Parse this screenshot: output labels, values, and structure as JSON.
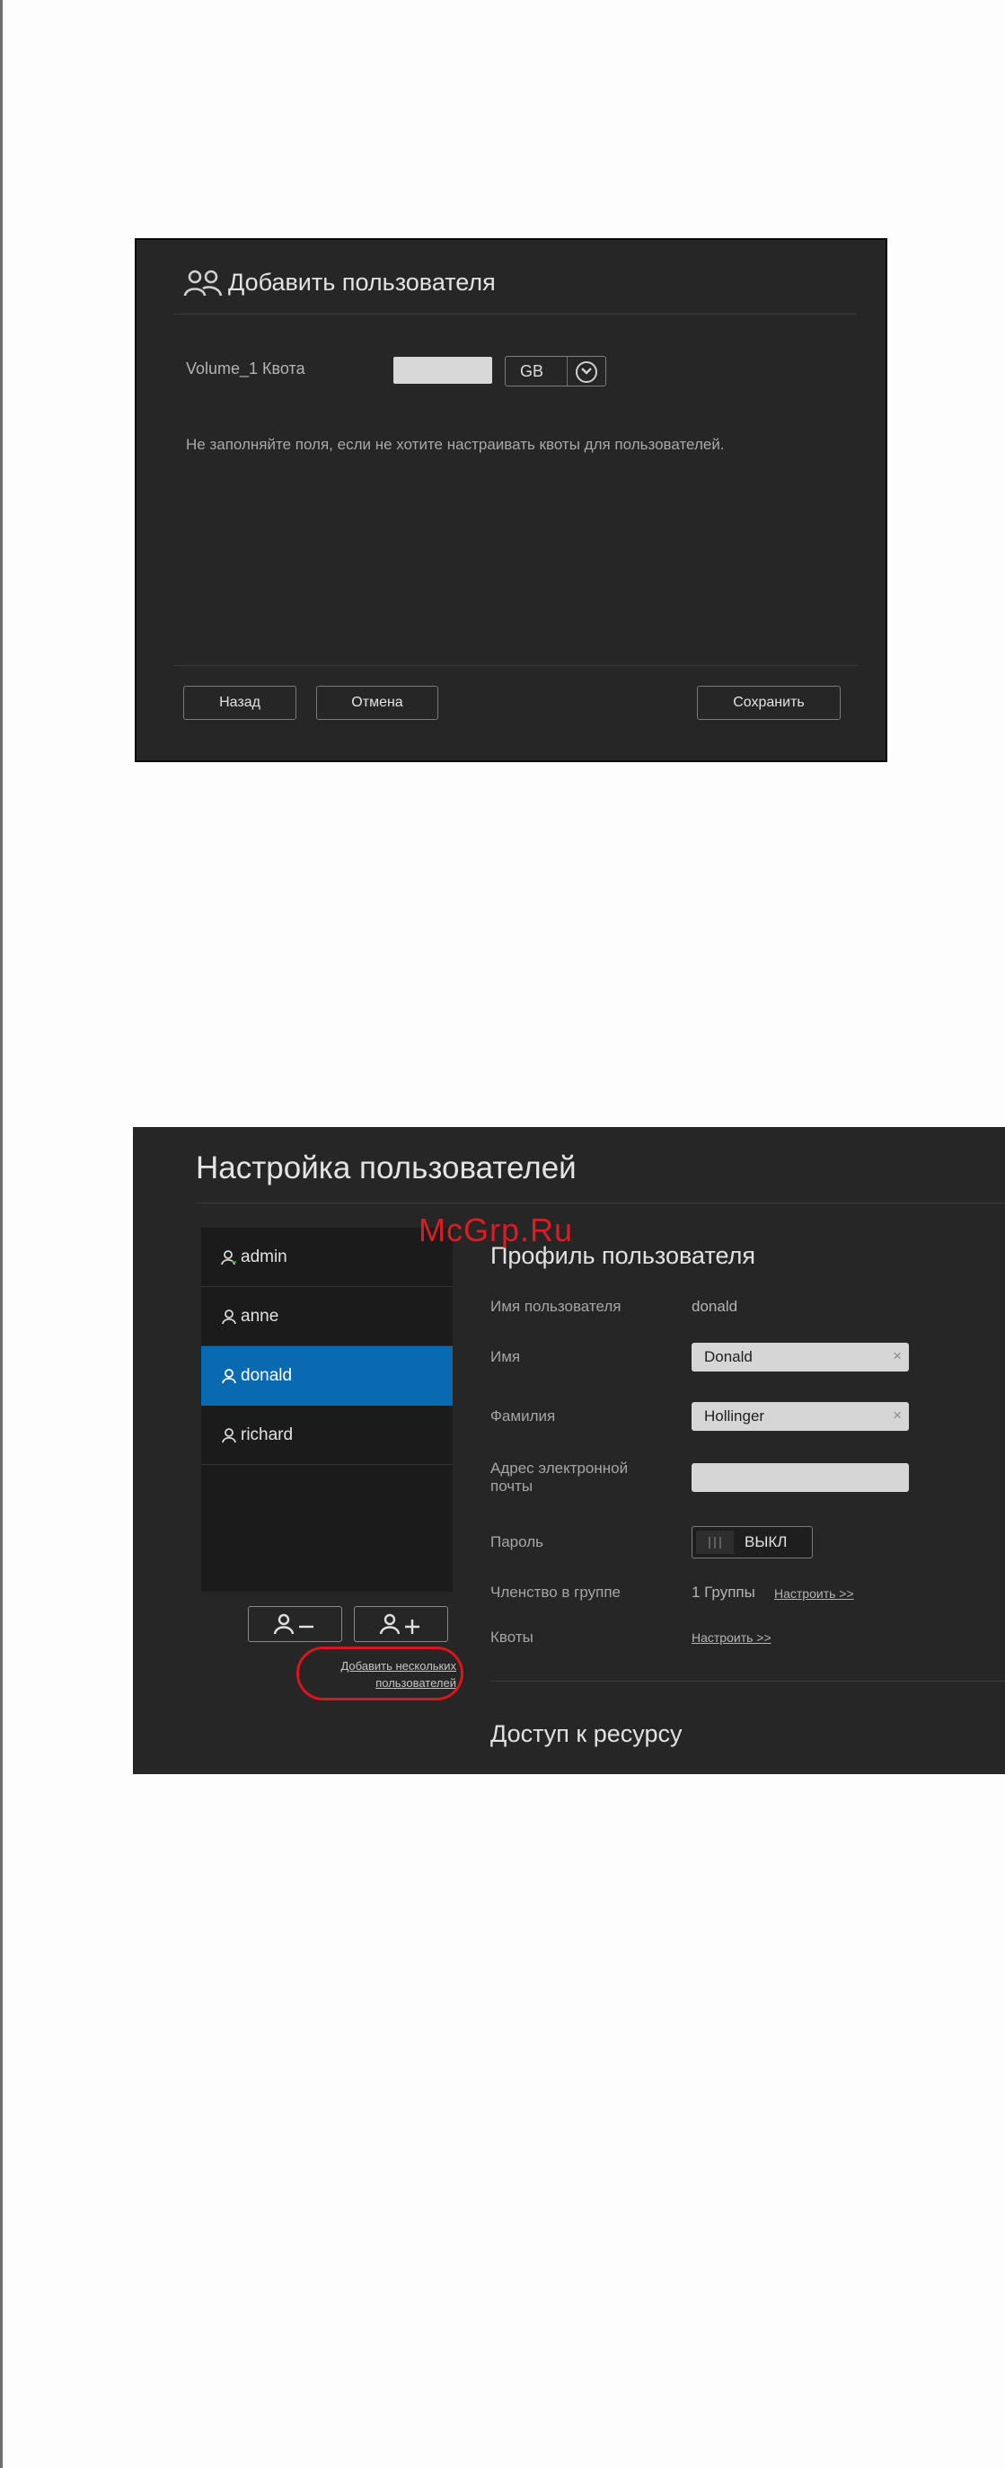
{
  "dialog": {
    "title": "Добавить пользователя",
    "quota_label": "Volume_1 Квота",
    "quota_value": "",
    "unit": "GB",
    "hint": "Не заполняйте поля, если не хотите настраивать квоты для пользователей.",
    "back_label": "Назад",
    "cancel_label": "Отмена",
    "save_label": "Сохранить"
  },
  "panel": {
    "title": "Настройка пользователей",
    "users": [
      {
        "name": "admin",
        "selected": false
      },
      {
        "name": "anne",
        "selected": false
      },
      {
        "name": "donald",
        "selected": true
      },
      {
        "name": "richard",
        "selected": false
      }
    ],
    "add_multiple_line1": "Добавить нескольких",
    "add_multiple_line2": "пользователей",
    "profile": {
      "title": "Профиль пользователя",
      "username_label": "Имя пользователя",
      "username_value": "donald",
      "first_name_label": "Имя",
      "first_name_value": "Donald",
      "last_name_label": "Фамилия",
      "last_name_value": "Hollinger",
      "email_label_line1": "Адрес электронной",
      "email_label_line2": "почты",
      "email_value": "",
      "password_label": "Пароль",
      "password_toggle": "ВЫКЛ",
      "group_label": "Членство в группе",
      "group_value": "1 Группы",
      "group_link": "Настроить >>",
      "quota_label": "Квоты",
      "quota_link": "Настроить >>"
    },
    "share_access_title": "Доступ к ресурсу"
  },
  "watermark": "McGrp.Ru",
  "colors": {
    "panel_bg": "#262626",
    "selected": "#0a6ab1",
    "highlight": "#d8161c"
  }
}
